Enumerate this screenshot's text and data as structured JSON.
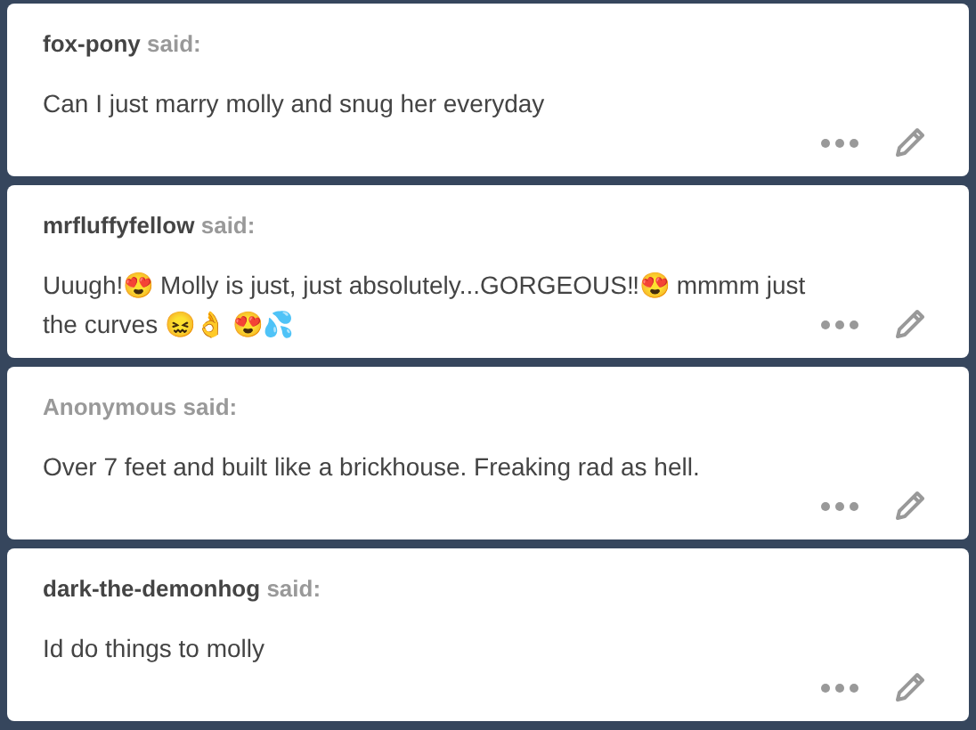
{
  "asks": [
    {
      "name": "fox-pony",
      "anonymous": false,
      "said": "said:",
      "text": "Can I just marry molly and snug her everyday"
    },
    {
      "name": "mrfluffyfellow",
      "anonymous": false,
      "said": "said:",
      "text": "Uuugh!😍 Molly is just, just absolutely...GORGEOUS‼😍 mmmm just the curves 😖👌 😍💦"
    },
    {
      "name": "Anonymous",
      "anonymous": true,
      "said": "said:",
      "text": "Over 7 feet and built like a brickhouse. Freaking rad as hell."
    },
    {
      "name": "dark-the-demonhog",
      "anonymous": false,
      "said": "said:",
      "text": "Id do things to molly"
    }
  ]
}
